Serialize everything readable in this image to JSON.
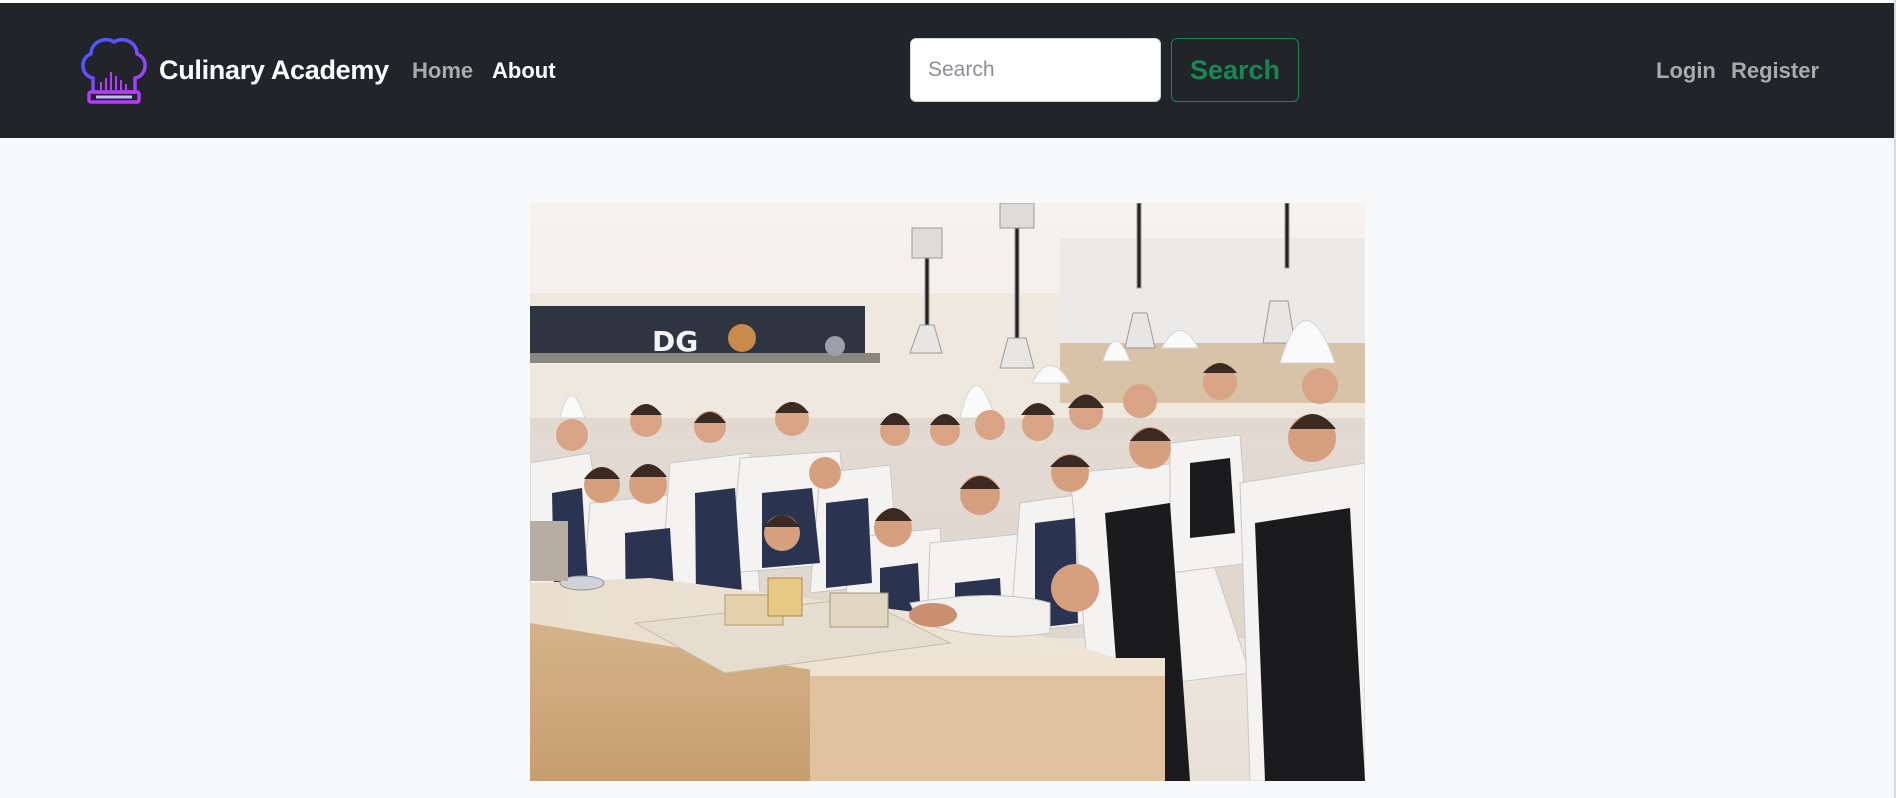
{
  "brand": {
    "name": "Culinary Academy",
    "logo_icon": "chef-hat-icon",
    "logo_colors": [
      "#3b5bff",
      "#b43cff"
    ]
  },
  "nav": {
    "home_label": "Home",
    "about_label": "About",
    "active": "About"
  },
  "search": {
    "placeholder": "Search",
    "value": "",
    "button_label": "Search",
    "accent": "#198754"
  },
  "auth": {
    "login_label": "Login",
    "register_label": "Register"
  },
  "hero": {
    "image_alt": "Group photo of chefs and students in a professional kitchen"
  },
  "colors": {
    "navbar": "#212529",
    "page_background": "#f8f9fb"
  }
}
